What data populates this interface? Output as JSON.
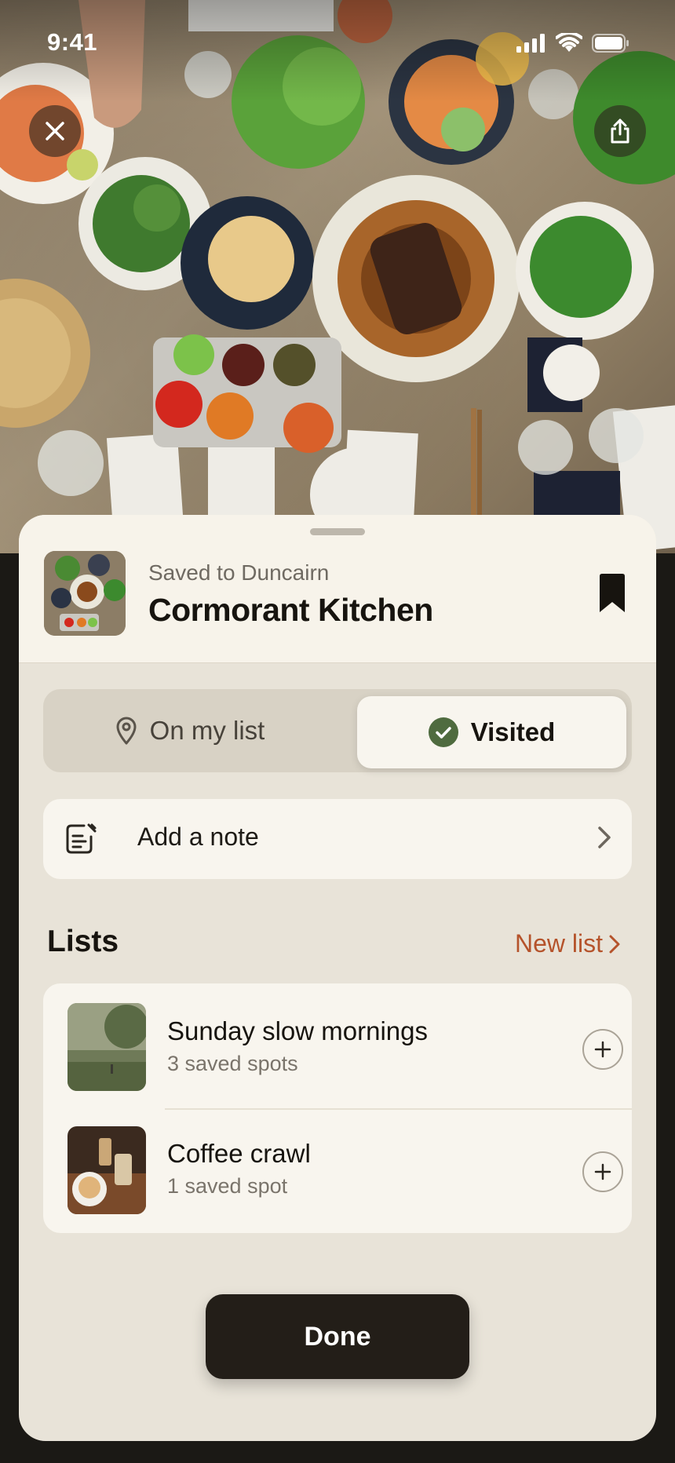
{
  "status_bar": {
    "time": "9:41"
  },
  "hero": {
    "description_icon": "food-table-photo"
  },
  "header": {
    "saved_to": "Saved to Duncairn",
    "place_name": "Cormorant Kitchen",
    "bookmark_icon": "bookmark-filled-icon"
  },
  "segment": {
    "options": [
      {
        "label": "On my list",
        "icon": "pin-icon",
        "selected": false
      },
      {
        "label": "Visited",
        "icon": "check-circle-icon",
        "selected": true
      }
    ]
  },
  "note": {
    "label": "Add a note",
    "icon": "note-edit-icon"
  },
  "lists": {
    "title": "Lists",
    "new_list_label": "New list",
    "items": [
      {
        "name": "Sunday slow mornings",
        "count": "3 saved spots"
      },
      {
        "name": "Coffee crawl",
        "count": "1 saved spot"
      }
    ]
  },
  "done_label": "Done",
  "colors": {
    "accent": "#b5532b",
    "visited_check": "#4f6b3f",
    "sheet_bg": "#e8e3d8",
    "card_bg": "#f8f5ee",
    "done_bg": "#231e18"
  }
}
